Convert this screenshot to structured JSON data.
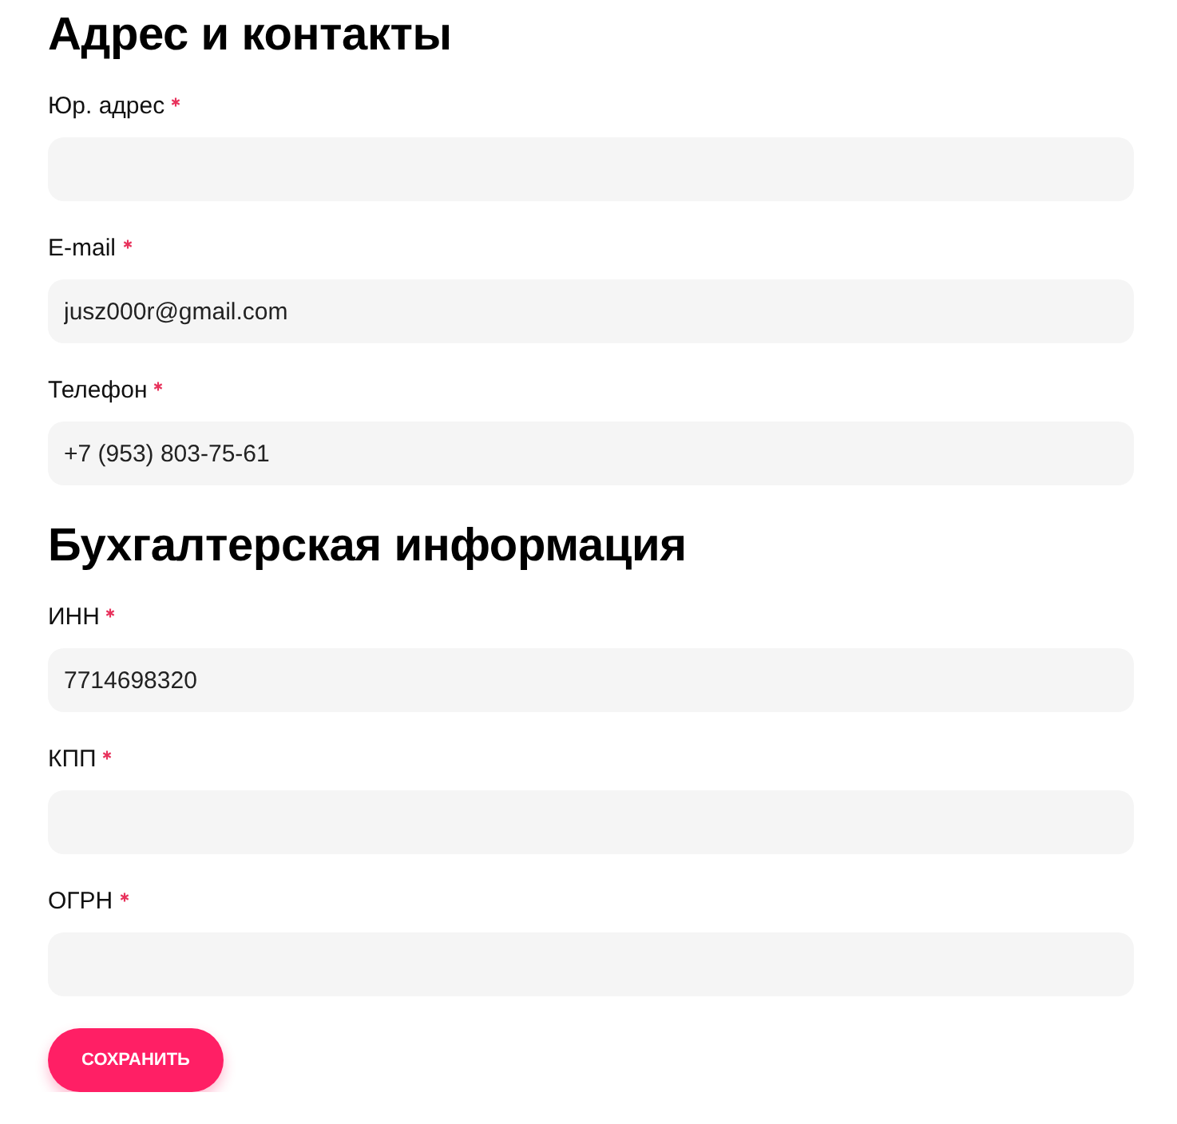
{
  "sections": [
    {
      "title": "Адрес и контакты",
      "fields": [
        {
          "label": "Юр. адрес",
          "required": true
        },
        {
          "label": "E-mail",
          "required": true,
          "value": "jusz000r@gmail.com"
        },
        {
          "label": "Телефон",
          "required": true,
          "value": "+7 (953) 803-75-61"
        }
      ]
    },
    {
      "title": "Бухгалтерская информация",
      "fields": [
        {
          "label": "ИНН",
          "required": true,
          "value": "7714698320"
        },
        {
          "label": "КПП",
          "required": true
        },
        {
          "label": "ОГРН",
          "required": true
        }
      ]
    }
  ],
  "save_button": {
    "label": "СОХРАНИТЬ"
  }
}
